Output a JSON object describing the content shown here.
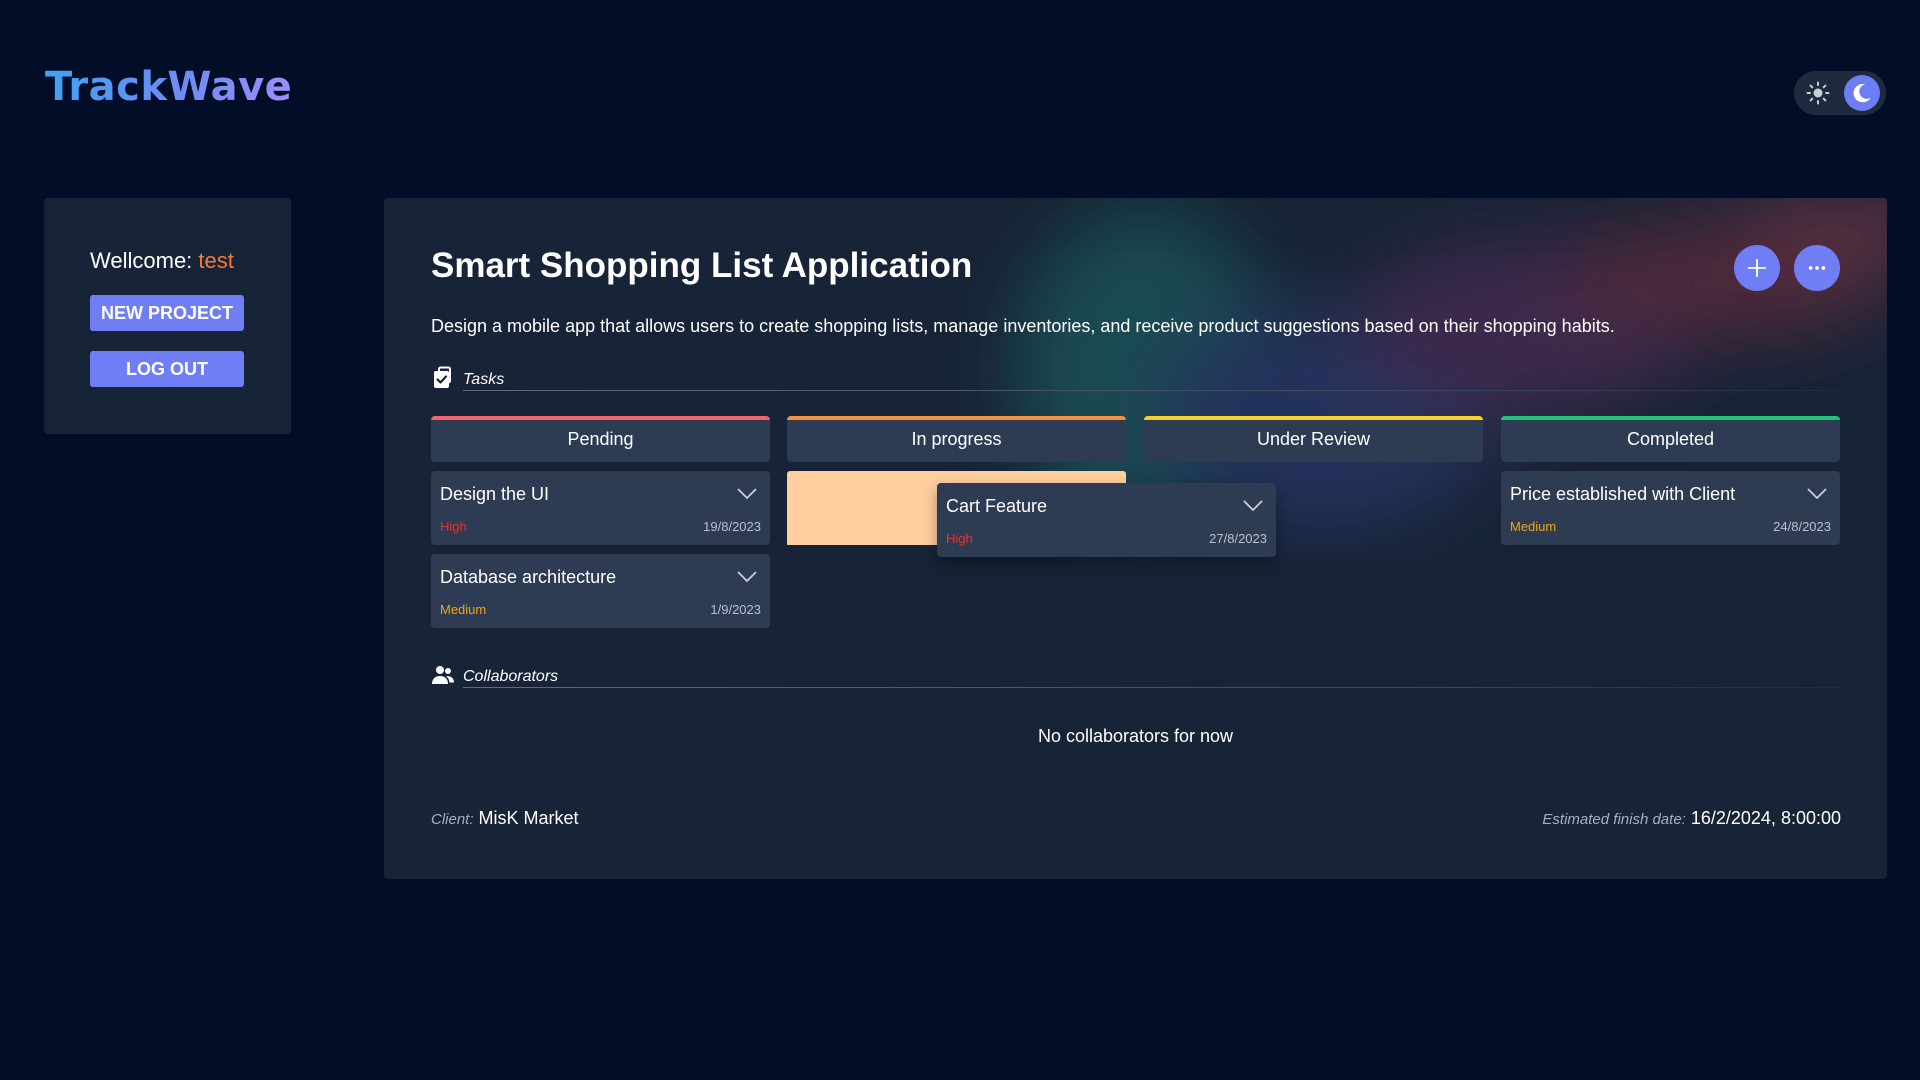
{
  "app": {
    "logo": "TrackWave"
  },
  "theme_toggle": {
    "light_icon": "sun-icon",
    "dark_icon": "moon-icon",
    "active": "dark"
  },
  "sidebar": {
    "welcome_label": "Wellcome:",
    "username": "test",
    "new_project_label": "NEW PROJECT",
    "logout_label": "LOG OUT"
  },
  "project": {
    "title": "Smart Shopping List Application",
    "description": "Design a mobile app that allows users to create shopping lists, manage inventories, and receive product suggestions based on their shopping habits.",
    "add_icon": "plus-icon",
    "more_icon": "ellipsis-icon",
    "tasks_label": "Tasks",
    "collaborators_label": "Collaborators",
    "no_collaborators": "No collaborators for now",
    "client_label": "Client:",
    "client_value": "MisK Market",
    "finish_label": "Estimated finish date:",
    "finish_value": "16/2/2024, 8:00:00"
  },
  "columns": [
    {
      "title": "Pending",
      "color": "#f0646a",
      "tasks": [
        {
          "title": "Design the UI",
          "priority": "High",
          "date": "19/8/2023"
        },
        {
          "title": "Database architecture",
          "priority": "Medium",
          "date": "1/9/2023"
        }
      ]
    },
    {
      "title": "In progress",
      "color": "#f5913f",
      "tasks": [
        {
          "title": "Cart Feature",
          "priority": "High",
          "date": "27/8/2023"
        }
      ]
    },
    {
      "title": "Under Review",
      "color": "#f7d02a",
      "tasks": []
    },
    {
      "title": "Completed",
      "color": "#1fc37a",
      "tasks": [
        {
          "title": "Price established with Client",
          "priority": "Medium",
          "date": "24/8/2023"
        }
      ]
    }
  ],
  "colors": {
    "background": "#020e28",
    "panel": "#172336",
    "card": "#2d3b53",
    "accent": "#6f7ef4",
    "priority_high": "#e8322f",
    "priority_medium": "#f5a512",
    "username": "#f57c38",
    "drop_placeholder": "#fecf9d"
  }
}
